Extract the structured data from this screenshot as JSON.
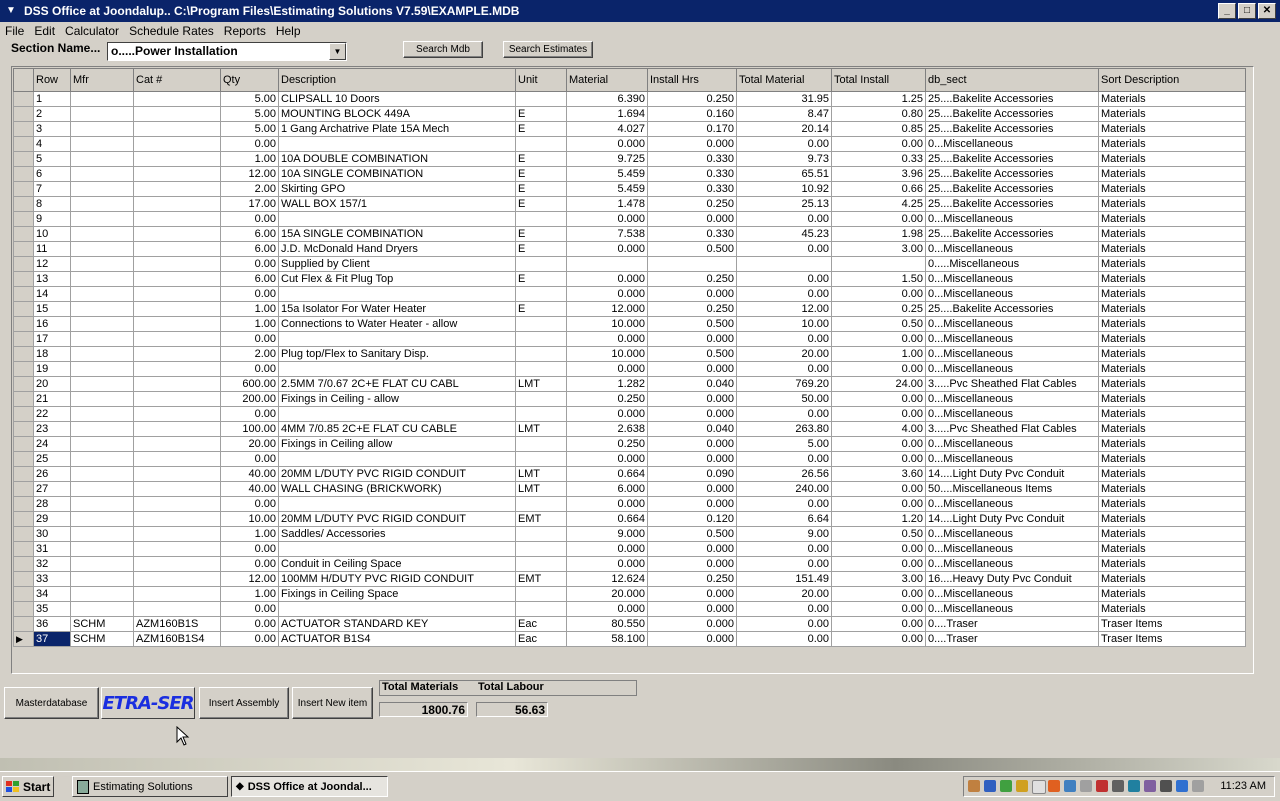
{
  "window": {
    "title": "DSS Office at Joondalup.. C:\\Program Files\\Estimating Solutions V7.59\\EXAMPLE.MDB"
  },
  "menu": [
    "File",
    "Edit",
    "Calculator",
    "Schedule Rates",
    "Reports",
    "Help"
  ],
  "section": {
    "label": "Section Name...",
    "value": "o.....Power Installation"
  },
  "buttons": {
    "search_mdb": "Search Mdb",
    "search_estimates": "Search Estimates",
    "masterdatabase": "Masterdatabase",
    "insert_assembly": "Insert  Assembly",
    "insert_new_item": "Insert  New item"
  },
  "logo_text": "ETRA-SER",
  "columns": [
    "Row",
    "Mfr",
    "Cat #",
    "Qty",
    "Description",
    "Unit",
    "Material",
    "Install Hrs",
    "Total Material",
    "Total Install",
    "db_sect",
    "Sort Description"
  ],
  "rows": [
    [
      "1",
      "",
      "",
      "5.00",
      "CLIPSALL 10        Doors",
      "",
      "6.390",
      "0.250",
      "31.95",
      "1.25",
      "25....Bakelite Accessories",
      "Materials"
    ],
    [
      "2",
      "",
      "",
      "5.00",
      "MOUNTING BLOCK  449A",
      "E",
      "1.694",
      "0.160",
      "8.47",
      "0.80",
      "25....Bakelite Accessories",
      "Materials"
    ],
    [
      "3",
      "",
      "",
      "5.00",
      "1 Gang Archatrive Plate 15A Mech",
      "E",
      "4.027",
      "0.170",
      "20.14",
      "0.85",
      "25....Bakelite Accessories",
      "Materials"
    ],
    [
      "4",
      "",
      "",
      "0.00",
      "",
      "",
      "0.000",
      "0.000",
      "0.00",
      "0.00",
      "0...Miscellaneous",
      "Materials"
    ],
    [
      "5",
      "",
      "",
      "1.00",
      "10A DOUBLE COMBINATION",
      "E",
      "9.725",
      "0.330",
      "9.73",
      "0.33",
      "25....Bakelite Accessories",
      "Materials"
    ],
    [
      "6",
      "",
      "",
      "12.00",
      "10A SINGLE COMBINATION",
      "E",
      "5.459",
      "0.330",
      "65.51",
      "3.96",
      "25....Bakelite Accessories",
      "Materials"
    ],
    [
      "7",
      "",
      "",
      "2.00",
      "Skirting GPO",
      "E",
      "5.459",
      "0.330",
      "10.92",
      "0.66",
      "25....Bakelite Accessories",
      "Materials"
    ],
    [
      "8",
      "",
      "",
      "17.00",
      "WALL BOX  157/1",
      "E",
      "1.478",
      "0.250",
      "25.13",
      "4.25",
      "25....Bakelite Accessories",
      "Materials"
    ],
    [
      "9",
      "",
      "",
      "0.00",
      "",
      "",
      "0.000",
      "0.000",
      "0.00",
      "0.00",
      "0...Miscellaneous",
      "Materials"
    ],
    [
      "10",
      "",
      "",
      "6.00",
      "15A SINGLE COMBINATION",
      "E",
      "7.538",
      "0.330",
      "45.23",
      "1.98",
      "25....Bakelite Accessories",
      "Materials"
    ],
    [
      "11",
      "",
      "",
      "6.00",
      "J.D. McDonald Hand Dryers",
      "E",
      "0.000",
      "0.500",
      "0.00",
      "3.00",
      "0...Miscellaneous",
      "Materials"
    ],
    [
      "12",
      "",
      "",
      "0.00",
      "Supplied by Client",
      "",
      "",
      "",
      "",
      "",
      "0.....Miscellaneous",
      "Materials"
    ],
    [
      "13",
      "",
      "",
      "6.00",
      "Cut Flex & Fit Plug Top",
      "E",
      "0.000",
      "0.250",
      "0.00",
      "1.50",
      "0...Miscellaneous",
      "Materials"
    ],
    [
      "14",
      "",
      "",
      "0.00",
      "",
      "",
      "0.000",
      "0.000",
      "0.00",
      "0.00",
      "0...Miscellaneous",
      "Materials"
    ],
    [
      "15",
      "",
      "",
      "1.00",
      "15a Isolator For Water Heater",
      "E",
      "12.000",
      "0.250",
      "12.00",
      "0.25",
      "25....Bakelite Accessories",
      "Materials"
    ],
    [
      "16",
      "",
      "",
      "1.00",
      "Connections to Water Heater - allow",
      "",
      "10.000",
      "0.500",
      "10.00",
      "0.50",
      "0...Miscellaneous",
      "Materials"
    ],
    [
      "17",
      "",
      "",
      "0.00",
      "",
      "",
      "0.000",
      "0.000",
      "0.00",
      "0.00",
      "0...Miscellaneous",
      "Materials"
    ],
    [
      "18",
      "",
      "",
      "2.00",
      "Plug top/Flex to Sanitary Disp.",
      "",
      "10.000",
      "0.500",
      "20.00",
      "1.00",
      "0...Miscellaneous",
      "Materials"
    ],
    [
      "19",
      "",
      "",
      "0.00",
      "",
      "",
      "0.000",
      "0.000",
      "0.00",
      "0.00",
      "0...Miscellaneous",
      "Materials"
    ],
    [
      "20",
      "",
      "",
      "600.00",
      "2.5MM 7/0.67 2C+E FLAT CU CABL",
      "LMT",
      "1.282",
      "0.040",
      "769.20",
      "24.00",
      "3.....Pvc Sheathed Flat Cables",
      "Materials"
    ],
    [
      "21",
      "",
      "",
      "200.00",
      "Fixings in Ceiling - allow",
      "",
      "0.250",
      "0.000",
      "50.00",
      "0.00",
      "0...Miscellaneous",
      "Materials"
    ],
    [
      "22",
      "",
      "",
      "0.00",
      "",
      "",
      "0.000",
      "0.000",
      "0.00",
      "0.00",
      "0...Miscellaneous",
      "Materials"
    ],
    [
      "23",
      "",
      "",
      "100.00",
      "4MM 7/0.85 2C+E FLAT CU CABLE",
      "LMT",
      "2.638",
      "0.040",
      "263.80",
      "4.00",
      "3.....Pvc Sheathed Flat Cables",
      "Materials"
    ],
    [
      "24",
      "",
      "",
      "20.00",
      "Fixings in Ceiling  allow",
      "",
      "0.250",
      "0.000",
      "5.00",
      "0.00",
      "0...Miscellaneous",
      "Materials"
    ],
    [
      "25",
      "",
      "",
      "0.00",
      "",
      "",
      "0.000",
      "0.000",
      "0.00",
      "0.00",
      "0...Miscellaneous",
      "Materials"
    ],
    [
      "26",
      "",
      "",
      "40.00",
      "20MM L/DUTY PVC RIGID CONDUIT",
      "LMT",
      "0.664",
      "0.090",
      "26.56",
      "3.60",
      "14....Light Duty Pvc Conduit",
      "Materials"
    ],
    [
      "27",
      "",
      "",
      "40.00",
      "WALL CHASING (BRICKWORK)",
      "LMT",
      "6.000",
      "0.000",
      "240.00",
      "0.00",
      "50....Miscellaneous Items",
      "Materials"
    ],
    [
      "28",
      "",
      "",
      "0.00",
      "",
      "",
      "0.000",
      "0.000",
      "0.00",
      "0.00",
      "0...Miscellaneous",
      "Materials"
    ],
    [
      "29",
      "",
      "",
      "10.00",
      "20MM L/DUTY PVC RIGID CONDUIT",
      "EMT",
      "0.664",
      "0.120",
      "6.64",
      "1.20",
      "14....Light Duty Pvc Conduit",
      "Materials"
    ],
    [
      "30",
      "",
      "",
      "1.00",
      "Saddles/ Accessories",
      "",
      "9.000",
      "0.500",
      "9.00",
      "0.50",
      "0...Miscellaneous",
      "Materials"
    ],
    [
      "31",
      "",
      "",
      "0.00",
      "",
      "",
      "0.000",
      "0.000",
      "0.00",
      "0.00",
      "0...Miscellaneous",
      "Materials"
    ],
    [
      "32",
      "",
      "",
      "0.00",
      "Conduit in Ceiling Space",
      "",
      "0.000",
      "0.000",
      "0.00",
      "0.00",
      "0...Miscellaneous",
      "Materials"
    ],
    [
      "33",
      "",
      "",
      "12.00",
      "100MM H/DUTY PVC RIGID CONDUIT",
      "EMT",
      "12.624",
      "0.250",
      "151.49",
      "3.00",
      "16....Heavy Duty Pvc Conduit",
      "Materials"
    ],
    [
      "34",
      "",
      "",
      "1.00",
      "Fixings in Ceiling Space",
      "",
      "20.000",
      "0.000",
      "20.00",
      "0.00",
      "0...Miscellaneous",
      "Materials"
    ],
    [
      "35",
      "",
      "",
      "0.00",
      "",
      "",
      "0.000",
      "0.000",
      "0.00",
      "0.00",
      "0...Miscellaneous",
      "Materials"
    ],
    [
      "36",
      "SCHM",
      "AZM160B1S",
      "0.00",
      "ACTUATOR STANDARD KEY",
      "Eac",
      "80.550",
      "0.000",
      "0.00",
      "0.00",
      "0....Traser",
      "Traser Items"
    ],
    [
      "37",
      "SCHM",
      "AZM160B1S4",
      "0.00",
      "ACTUATOR B1S4",
      "Eac",
      "58.100",
      "0.000",
      "0.00",
      "0.00",
      "0....Traser",
      "Traser Items"
    ]
  ],
  "totals": {
    "materials_label": "Total Materials",
    "labour_label": "Total Labour",
    "materials": "1800.76",
    "labour": "56.63"
  },
  "taskbar": {
    "start": "Start",
    "tasks": [
      "Estimating Solutions",
      "DSS Office at Joondal..."
    ],
    "clock": "11:23 AM"
  },
  "colors": {
    "titlebar": "#0a246a",
    "window_bg": "#d4d0c8",
    "logo_text": "#1a2ee0"
  }
}
